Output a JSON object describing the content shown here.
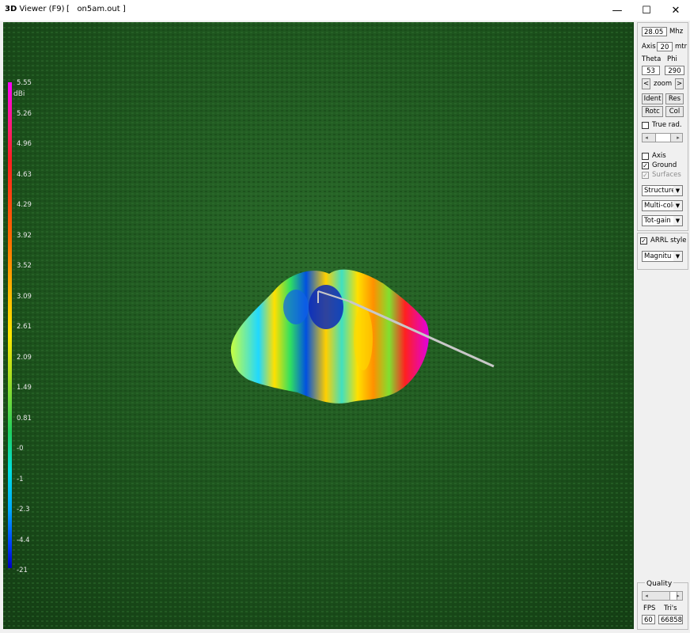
{
  "window": {
    "title_prefix": "3D",
    "title": "Viewer (F9)",
    "file": "[   on5am.out ]",
    "minimize": "—",
    "maximize": "☐",
    "close": "✕"
  },
  "legend": {
    "unit": "dBi",
    "labels": [
      "5.55",
      "5.26",
      "4.96",
      "4.63",
      "4.29",
      "3.92",
      "3.52",
      "3.09",
      "2.61",
      "2.09",
      "1.49",
      "0.81",
      "-0",
      "-1",
      "-2.3",
      "-4.4",
      "-21"
    ]
  },
  "controls": {
    "frequency_value": "28.05",
    "frequency_unit": "Mhz",
    "axis_label": "Axis",
    "axis_value": "20",
    "axis_unit": "mtr",
    "theta_label": "Theta",
    "phi_label": "Phi",
    "theta_value": "53",
    "phi_value": "290",
    "zoom_prev": "<",
    "zoom_label": "zoom",
    "zoom_next": ">",
    "ident_label": "Ident",
    "res_label": "Res",
    "rotc_label": "Rotc",
    "col_label": "Col",
    "true_rad_label": "True rad.",
    "true_rad_checked": false,
    "axis_check_label": "Axis",
    "axis_checked": false,
    "ground_label": "Ground",
    "ground_checked": true,
    "surfaces_label": "Surfaces",
    "surfaces_checked": true,
    "structure_select": "Structure",
    "color_select": "Multi-colo",
    "gain_select": "Tot-gain",
    "arrl_style_label": "ARRL style",
    "arrl_style_checked": true,
    "magnitude_select": "Magnitu"
  },
  "quality": {
    "title": "Quality",
    "fps_label": "FPS",
    "tris_label": "Tri's",
    "fps_value": "60",
    "tris_value": "66858"
  },
  "colors": {
    "ground": "#1f5a1f",
    "wire": "#c8c8c8"
  }
}
